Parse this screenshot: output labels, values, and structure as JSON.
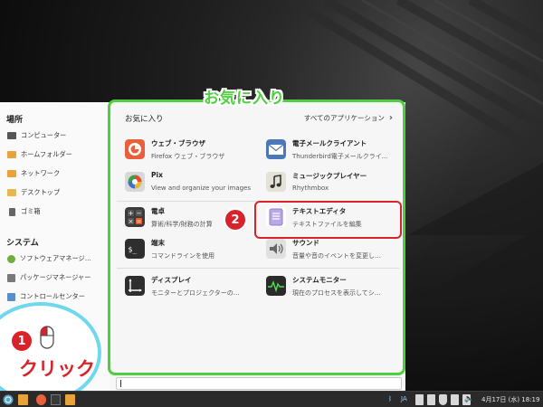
{
  "places": {
    "title": "場所",
    "items": [
      {
        "label": "コンピューター",
        "icon": "computer-icon",
        "color": "#555555"
      },
      {
        "label": "ホームフォルダー",
        "icon": "home-folder-icon",
        "color": "#e8a33a"
      },
      {
        "label": "ネットワーク",
        "icon": "network-icon",
        "color": "#e8a33a"
      },
      {
        "label": "デスクトップ",
        "icon": "desktop-folder-icon",
        "color": "#e8b84a"
      },
      {
        "label": "ゴミ箱",
        "icon": "trash-icon",
        "color": "#666666"
      }
    ]
  },
  "system": {
    "title": "システム",
    "items": [
      {
        "label": "ソフトウェアマネージ…",
        "icon": "software-manager-icon",
        "color": "#6fae3a"
      },
      {
        "label": "パッケージマネージャー",
        "icon": "package-manager-icon",
        "color": "#7a7a7a"
      },
      {
        "label": "コントロールセンター",
        "icon": "control-center-icon",
        "color": "#5b8ccc"
      }
    ]
  },
  "favorites": {
    "title": "お気に入り",
    "all_apps_label": "すべてのアプリケーション",
    "apps": [
      {
        "name": "ウェブ・ブラウザ",
        "desc": "Firefox ウェブ・ブラウザ",
        "icon": "firefox-icon"
      },
      {
        "name": "電子メールクライアント",
        "desc": "Thunderbird電子メールクライ…",
        "icon": "mail-icon"
      },
      {
        "name": "Pix",
        "desc": "View and organize your images",
        "icon": "pix-icon"
      },
      {
        "name": "ミュージックプレイヤー",
        "desc": "Rhythmbox",
        "icon": "music-icon"
      },
      {
        "name": "電卓",
        "desc": "算術/科学/財務の計算",
        "icon": "calculator-icon"
      },
      {
        "name": "テキストエディタ",
        "desc": "テキストファイルを編集",
        "icon": "text-editor-icon"
      },
      {
        "name": "端末",
        "desc": "コマンドラインを使用",
        "icon": "terminal-icon"
      },
      {
        "name": "サウンド",
        "desc": "音量や音のイベントを変更し…",
        "icon": "sound-icon"
      },
      {
        "name": "ディスプレイ",
        "desc": "モニターとプロジェクターの…",
        "icon": "display-icon"
      },
      {
        "name": "システムモニター",
        "desc": "現在のプロセスを表示してシ…",
        "icon": "system-monitor-icon"
      }
    ]
  },
  "annotations": {
    "favorites_label": "お気に入り",
    "step1": "1",
    "step2": "2",
    "click_label": "クリック",
    "frame_color": "#4fcf3f",
    "highlight_color": "#d9232b",
    "callout_color": "#6fd8ee"
  },
  "taskbar": {
    "input_method": "JA",
    "clock": "4月17日 (水) 18:19"
  }
}
